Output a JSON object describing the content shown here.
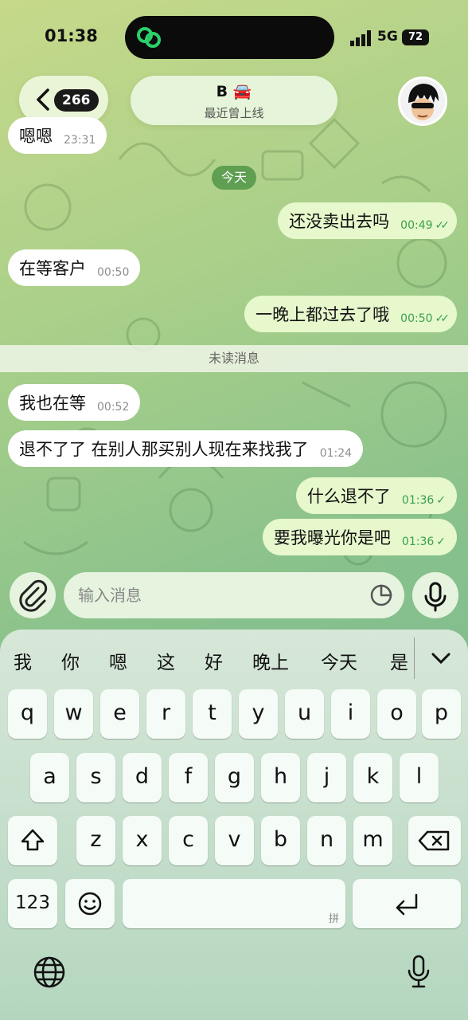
{
  "status_bar": {
    "time": "01:38",
    "network": "5G",
    "battery": "72"
  },
  "header": {
    "unread_count": "266",
    "contact_name": "B 🚘",
    "contact_status": "最近曾上线"
  },
  "chat": {
    "partial_message": {
      "text": "嗯嗯",
      "time": "23:31"
    },
    "date_divider": "今天",
    "messages": [
      {
        "dir": "out",
        "text": "还没卖出去吗",
        "time": "00:49",
        "status": "read"
      },
      {
        "dir": "in",
        "text": "在等客户",
        "time": "00:50"
      },
      {
        "dir": "out",
        "text": "一晚上都过去了哦",
        "time": "00:50",
        "status": "read"
      },
      {
        "dir": "in",
        "text": "我也在等",
        "time": "00:52"
      },
      {
        "dir": "in",
        "text": "退不了了 在别人那买别人现在来找我了",
        "time": "01:24"
      },
      {
        "dir": "out",
        "text": "什么退不了",
        "time": "01:36",
        "status": "sent"
      },
      {
        "dir": "out",
        "text": "要我曝光你是吧",
        "time": "01:36",
        "status": "sent"
      }
    ],
    "unread_divider": "未读消息"
  },
  "composer": {
    "placeholder": "输入消息"
  },
  "keyboard": {
    "candidates": [
      "我",
      "你",
      "嗯",
      "这",
      "好",
      "晚上",
      "今天",
      "是"
    ],
    "row1": [
      "q",
      "w",
      "e",
      "r",
      "t",
      "y",
      "u",
      "i",
      "o",
      "p"
    ],
    "row2": [
      "a",
      "s",
      "d",
      "f",
      "g",
      "h",
      "j",
      "k",
      "l"
    ],
    "row3": [
      "z",
      "x",
      "c",
      "v",
      "b",
      "n",
      "m"
    ],
    "numbers_key": "123",
    "space_hint": "拼"
  },
  "colors": {
    "outgoing_bubble": "#e6f8cc",
    "incoming_bubble": "#ffffff",
    "read_tick": "#3aa04b",
    "date_pill": "#5e9f52"
  },
  "icons": [
    "back-chevron-icon",
    "attach-paperclip-icon",
    "sticker-icon",
    "mic-icon",
    "shift-icon",
    "backspace-icon",
    "emoji-icon",
    "return-icon",
    "globe-icon",
    "dictation-mic-icon",
    "chevron-down-icon"
  ]
}
